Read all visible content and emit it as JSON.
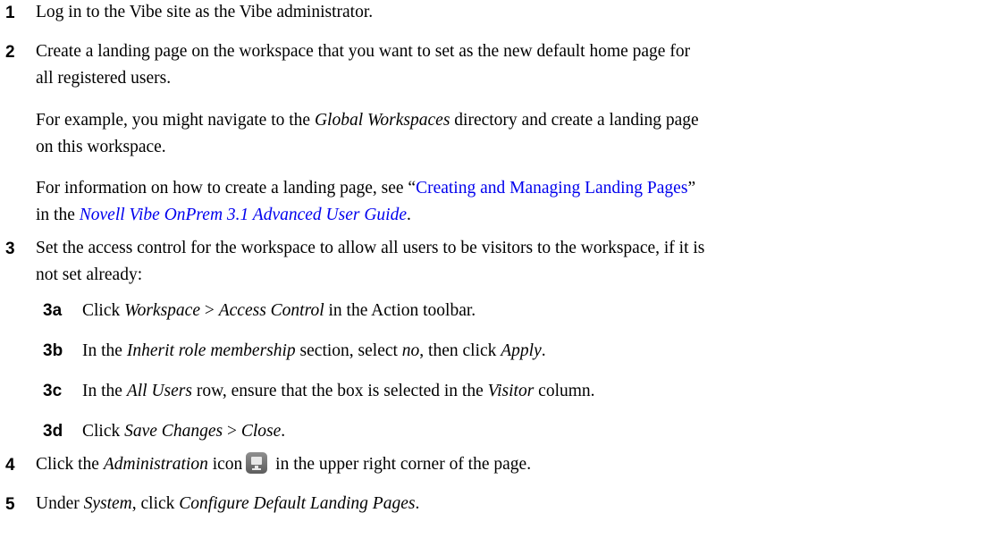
{
  "steps": [
    {
      "num": "1",
      "text": "Log in to the Vibe site as the Vibe administrator."
    },
    {
      "num": "2",
      "line1": "Create a landing page on the workspace that you want to set as the new default home page for",
      "line2": "all registered users.",
      "p1_a": "For example, you might navigate to the ",
      "p1_b": "Global Workspaces",
      "p1_c": " directory and create a landing page",
      "p1_line2": "on this workspace.",
      "p2_a": "For information on how to create a landing page, see “",
      "p2_link": "Creating and Managing Landing Pages",
      "p2_b": "”",
      "p2_c": "in the ",
      "p2_link2": "Novell Vibe OnPrem 3.1 Advanced User Guide",
      "p2_d": "."
    },
    {
      "num": "3",
      "line1": "Set the access control for the workspace to allow all users to be visitors to the workspace, if it is",
      "line2": "not set already:"
    },
    {
      "num": "4",
      "a": "Click the ",
      "b": "Administration",
      "c": " icon",
      "d": " in the upper right corner of the page."
    },
    {
      "num": "5",
      "a": "Under ",
      "b": "System",
      "c": ", click ",
      "d": "Configure Default Landing Pages",
      "e": "."
    }
  ],
  "substeps": [
    {
      "num": "3a",
      "a": "Click ",
      "b": "Workspace",
      "c": " > ",
      "d": "Access Control",
      "e": " in the Action toolbar."
    },
    {
      "num": "3b",
      "a": "In the ",
      "b": "Inherit role membership",
      "c": " section, select ",
      "d": "no",
      "e": ", then click ",
      "f": "Apply",
      "g": "."
    },
    {
      "num": "3c",
      "a": "In the ",
      "b": "All Users",
      "c": " row, ensure that the box is selected in the ",
      "d": "Visitor",
      "e": " column."
    },
    {
      "num": "3d",
      "a": "Click ",
      "b": "Save Changes",
      "c": " > ",
      "d": "Close",
      "e": "."
    }
  ],
  "icons": {
    "administration": "monitor-icon"
  }
}
